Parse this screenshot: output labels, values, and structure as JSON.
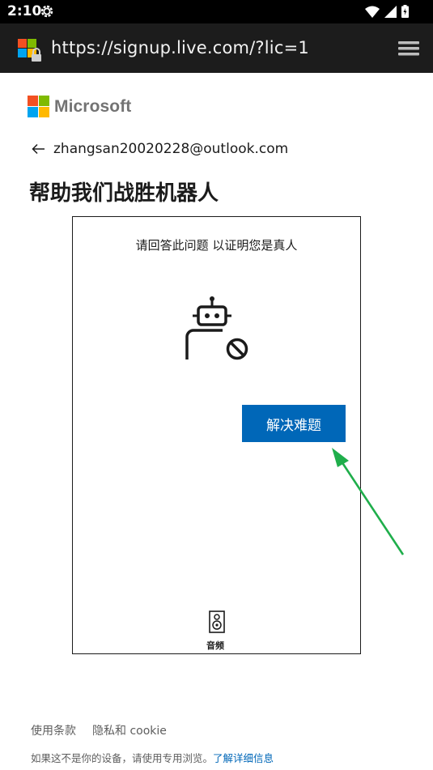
{
  "status_bar": {
    "time": "2:10",
    "icons": [
      "settings-icon",
      "wifi-icon",
      "signal-icon",
      "battery-charging-icon"
    ]
  },
  "browser": {
    "url": "https://signup.live.com/?lic=1",
    "menu_icon": "menu-icon"
  },
  "page": {
    "brand": "Microsoft",
    "email": "zhangsan20020228@outlook.com",
    "title": "帮助我们战胜机器人",
    "challenge": {
      "prompt": "请回答此问题 以证明您是真人",
      "icon": "robot-block-icon",
      "solve_button": "解决难题",
      "audio_label": "音频",
      "audio_icon": "speaker-icon"
    },
    "footer": {
      "terms": "使用条款",
      "privacy": "隐私和 cookie",
      "note": "如果这不是你的设备，请使用专用浏览。",
      "learn_more": "了解详细信息"
    }
  },
  "colors": {
    "accent": "#0067b8",
    "annotation": "#1fae4b",
    "ms_red": "#f25022",
    "ms_green": "#7fba00",
    "ms_blue": "#00a4ef",
    "ms_yellow": "#ffb900"
  }
}
